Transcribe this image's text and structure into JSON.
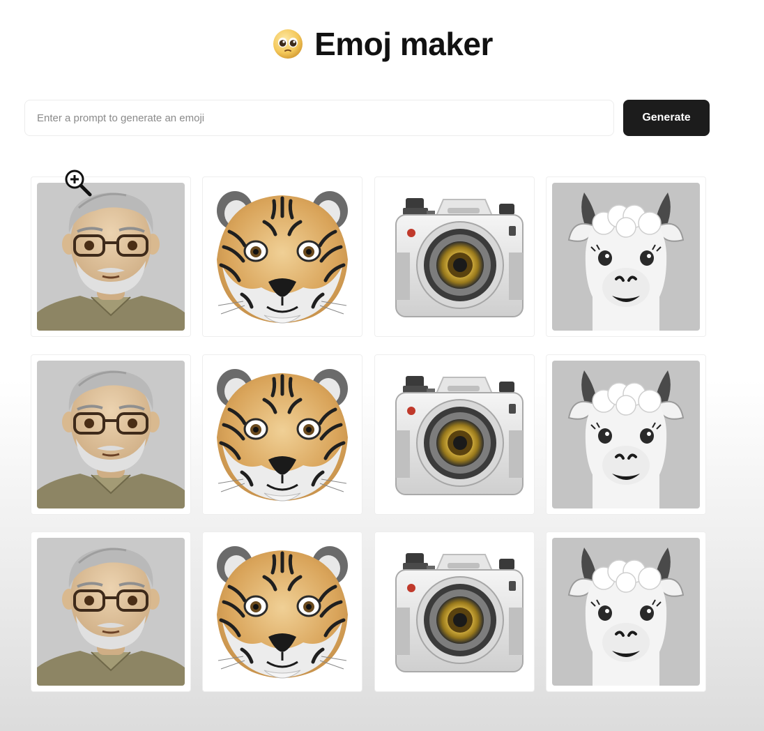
{
  "app": {
    "title_emoji": "🥺",
    "title": "Emoj maker"
  },
  "search": {
    "placeholder": "Enter a prompt to generate an emoji",
    "value": ""
  },
  "toolbar": {
    "generate_label": "Generate"
  },
  "colors": {
    "button_bg": "#1c1c1c",
    "button_text": "#ffffff",
    "card_border": "#eeeeee"
  },
  "gallery": {
    "columns": [
      "person-emoji",
      "tiger-emoji",
      "camera-emoji",
      "llama-emoji"
    ],
    "rows": 3
  },
  "cursor": {
    "icon": "zoom-in-icon"
  }
}
